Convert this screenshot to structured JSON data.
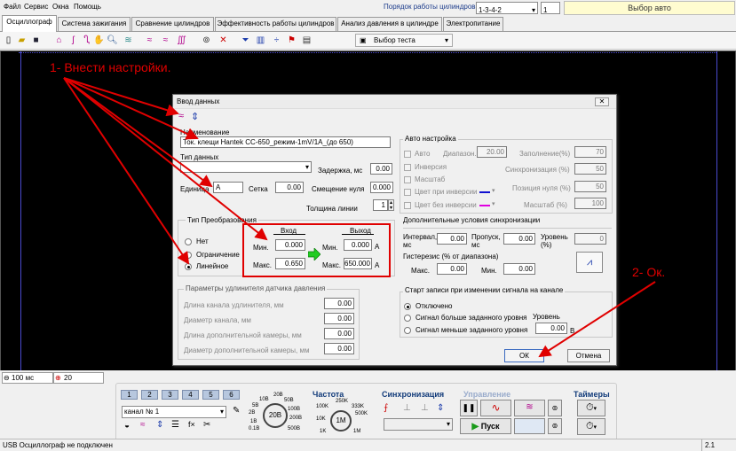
{
  "menu": {
    "file": "Файл",
    "service": "Сервис",
    "window": "Окна",
    "help": "Помощь"
  },
  "cylinder_order": {
    "label": "Порядок работы цилиндров",
    "value": "1-3-4-2",
    "count": "1"
  },
  "auto_select": "Выбор авто",
  "tabs": [
    "Осциллограф",
    "Система зажигания",
    "Сравнение цилиндров",
    "Эффективность работы цилиндров",
    "Анализ давления в цилиндре",
    "Электропитание"
  ],
  "toolbar": {
    "test_select": "Выбор теста"
  },
  "annotations": {
    "one": "1- Внести настройки.",
    "two": "2- Ок."
  },
  "dialog": {
    "title": "Ввод данных",
    "name_label": "Наименование",
    "name_value": "Ток. клещи Hantek CC-650_режим-1mV/1A_(до 650)",
    "type_label": "Тип данных",
    "delay_label": "Задержка, мс",
    "delay_value": "0.00",
    "unit_label": "Единица",
    "unit_value": "A",
    "grid_label": "Сетка",
    "grid_value": "0.00",
    "zero_offset_label": "Смещение нуля",
    "zero_offset_value": "0.000",
    "line_thickness_label": "Толщина линии",
    "line_thickness_value": "1",
    "transform": {
      "title": "Тип Преобразования",
      "options": [
        "Нет",
        "Ограничение",
        "Линейное"
      ],
      "input_label": "Вход",
      "output_label": "Выход",
      "min_label": "Мин.",
      "max_label": "Макс.",
      "in_min": "0.000",
      "in_max": "0.650",
      "out_min": "0.000",
      "out_max": "650.000",
      "unit": "A"
    },
    "extender": {
      "title": "Параметры удлинителя датчика давления",
      "rows": [
        {
          "label": "Длина канала удлинителя, мм",
          "value": "0.00"
        },
        {
          "label": "Диаметр канала, мм",
          "value": "0.00"
        },
        {
          "label": "Длина дополнительной камеры, мм",
          "value": "0.00"
        },
        {
          "label": "Диаметр дополнительной камеры, мм",
          "value": "0.00"
        }
      ]
    },
    "auto": {
      "title": "Авто настройка",
      "auto_label": "Авто",
      "range_label": "Диапазон.",
      "range_value": "20.00",
      "fill_label": "Заполнение(%)",
      "fill_value": "70",
      "inversion_label": "Инверсия",
      "sync_label": "Синхронизация (%)",
      "sync_value": "50",
      "scale_label": "Масштаб",
      "zero_pos_label": "Позиция нуля (%)",
      "zero_pos_value": "50",
      "color_inv_label": "Цвет при инверсии",
      "scale_pct_label": "Масштаб (%)",
      "scale_pct_value": "100",
      "color_noinv_label": "Цвет без инверсии",
      "color_inv": "#1010d0",
      "color_noinv": "#e000e0"
    },
    "sync": {
      "title": "Дополнительные условия синхронизации",
      "interval_label": "Интервал, мс",
      "interval_value": "0.00",
      "skip_label": "Пропуск, мс",
      "skip_value": "0.00",
      "level_label": "Уровень (%)",
      "level_value": "0",
      "hyst_label": "Гистерезис (% от диапазона)",
      "max_label": "Макс.",
      "max_value": "0.00",
      "min_label": "Мин.",
      "min_value": "0.00"
    },
    "record": {
      "title": "Старт записи при изменении сигнала на канале",
      "options": [
        "Отключено",
        "Сигнал больше заданного уровня",
        "Сигнал меньше заданного уровня"
      ],
      "level_label": "Уровень",
      "level_value": "0.00",
      "level_unit": "В"
    },
    "ok": "ОК",
    "cancel": "Отмена"
  },
  "bottom": {
    "time_value": "100 мс",
    "count_value": "20",
    "channel_buttons": [
      "1",
      "2",
      "3",
      "4",
      "5",
      "6"
    ],
    "channel_name": "канал № 1",
    "dial_small": [
      "10В",
      "20В",
      "50В",
      "100В",
      "200В",
      "500В",
      "0.1В",
      "0.2В",
      "0.5В",
      "1В",
      "2В",
      "5В"
    ],
    "dial_value": "20В",
    "freq_title": "Частота",
    "freq_labels": [
      "250K",
      "100K",
      "333K",
      "10K",
      "500K",
      "1K",
      "1M"
    ],
    "freq_value": "1M",
    "sync_title": "Синхронизация",
    "control_title": "Управление",
    "start": "Пуск",
    "timers_title": "Таймеры"
  },
  "status": {
    "left": "USB Осциллограф не подключен",
    "right": "2.1"
  },
  "accent": {
    "annotation": "#e00000",
    "arrow": "#e00000",
    "highlight_box": "#e00000",
    "green_arrow": "#22cc22"
  }
}
